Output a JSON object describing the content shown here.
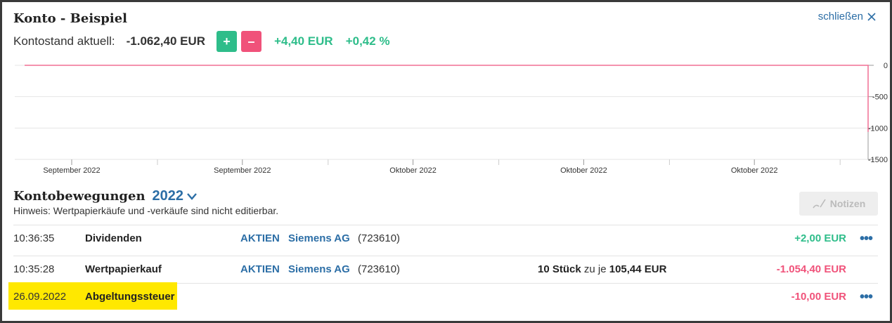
{
  "header": {
    "title": "Konto - Beispiel",
    "close_label": "schließen"
  },
  "balance": {
    "label": "Kontostand aktuell:",
    "value": "-1.062,40 EUR",
    "plus_label": "+",
    "minus_label": "–",
    "change_abs": "+4,40 EUR",
    "change_pct": "+0,42 %"
  },
  "chart_data": {
    "type": "line",
    "title": "",
    "xlabel": "",
    "ylabel": "",
    "x_tick_labels": [
      "September 2022",
      "September 2022",
      "Oktober 2022",
      "Oktober 2022",
      "Oktober 2022"
    ],
    "y_tick_labels": [
      "0",
      "-500",
      "-1000",
      "-1500"
    ],
    "y_ticks": [
      0,
      -500,
      -1000,
      -1500
    ],
    "ylim": [
      -1500,
      0
    ],
    "grid": true,
    "axis_side": "right",
    "series": [
      {
        "color": "#f06f93",
        "points": [
          {
            "t": 0.0,
            "y": 0
          },
          {
            "t": 1.0,
            "y": 0
          },
          {
            "t": 1.0,
            "y": -1062.4
          }
        ]
      }
    ]
  },
  "movements": {
    "title": "Kontobewegungen",
    "year": "2022",
    "hint": "Hinweis: Wertpapierkäufe und -verkäufe sind nicht editierbar.",
    "notes_label": "Notizen",
    "rows": [
      {
        "time": "10:36:35",
        "type": "Dividenden",
        "category": "AKTIEN",
        "name": "Siemens AG",
        "wkn": "(723610)",
        "qty": "",
        "qty_mid": "",
        "price": "",
        "amount": "+2,00 EUR",
        "amount_sign": "pos",
        "more": "•••"
      },
      {
        "time": "10:35:28",
        "type": "Wertpapierkauf",
        "category": "AKTIEN",
        "name": "Siemens AG",
        "wkn": "(723610)",
        "qty": "10 Stück",
        "qty_mid": " zu je ",
        "price": "105,44 EUR",
        "amount": "-1.054,40 EUR",
        "amount_sign": "neg",
        "more": ""
      },
      {
        "time": "26.09.2022",
        "type": "Abgeltungssteuer",
        "category": "",
        "name": "",
        "wkn": "",
        "qty": "",
        "qty_mid": "",
        "price": "",
        "amount": "-10,00 EUR",
        "amount_sign": "neg",
        "more": "•••"
      }
    ]
  }
}
